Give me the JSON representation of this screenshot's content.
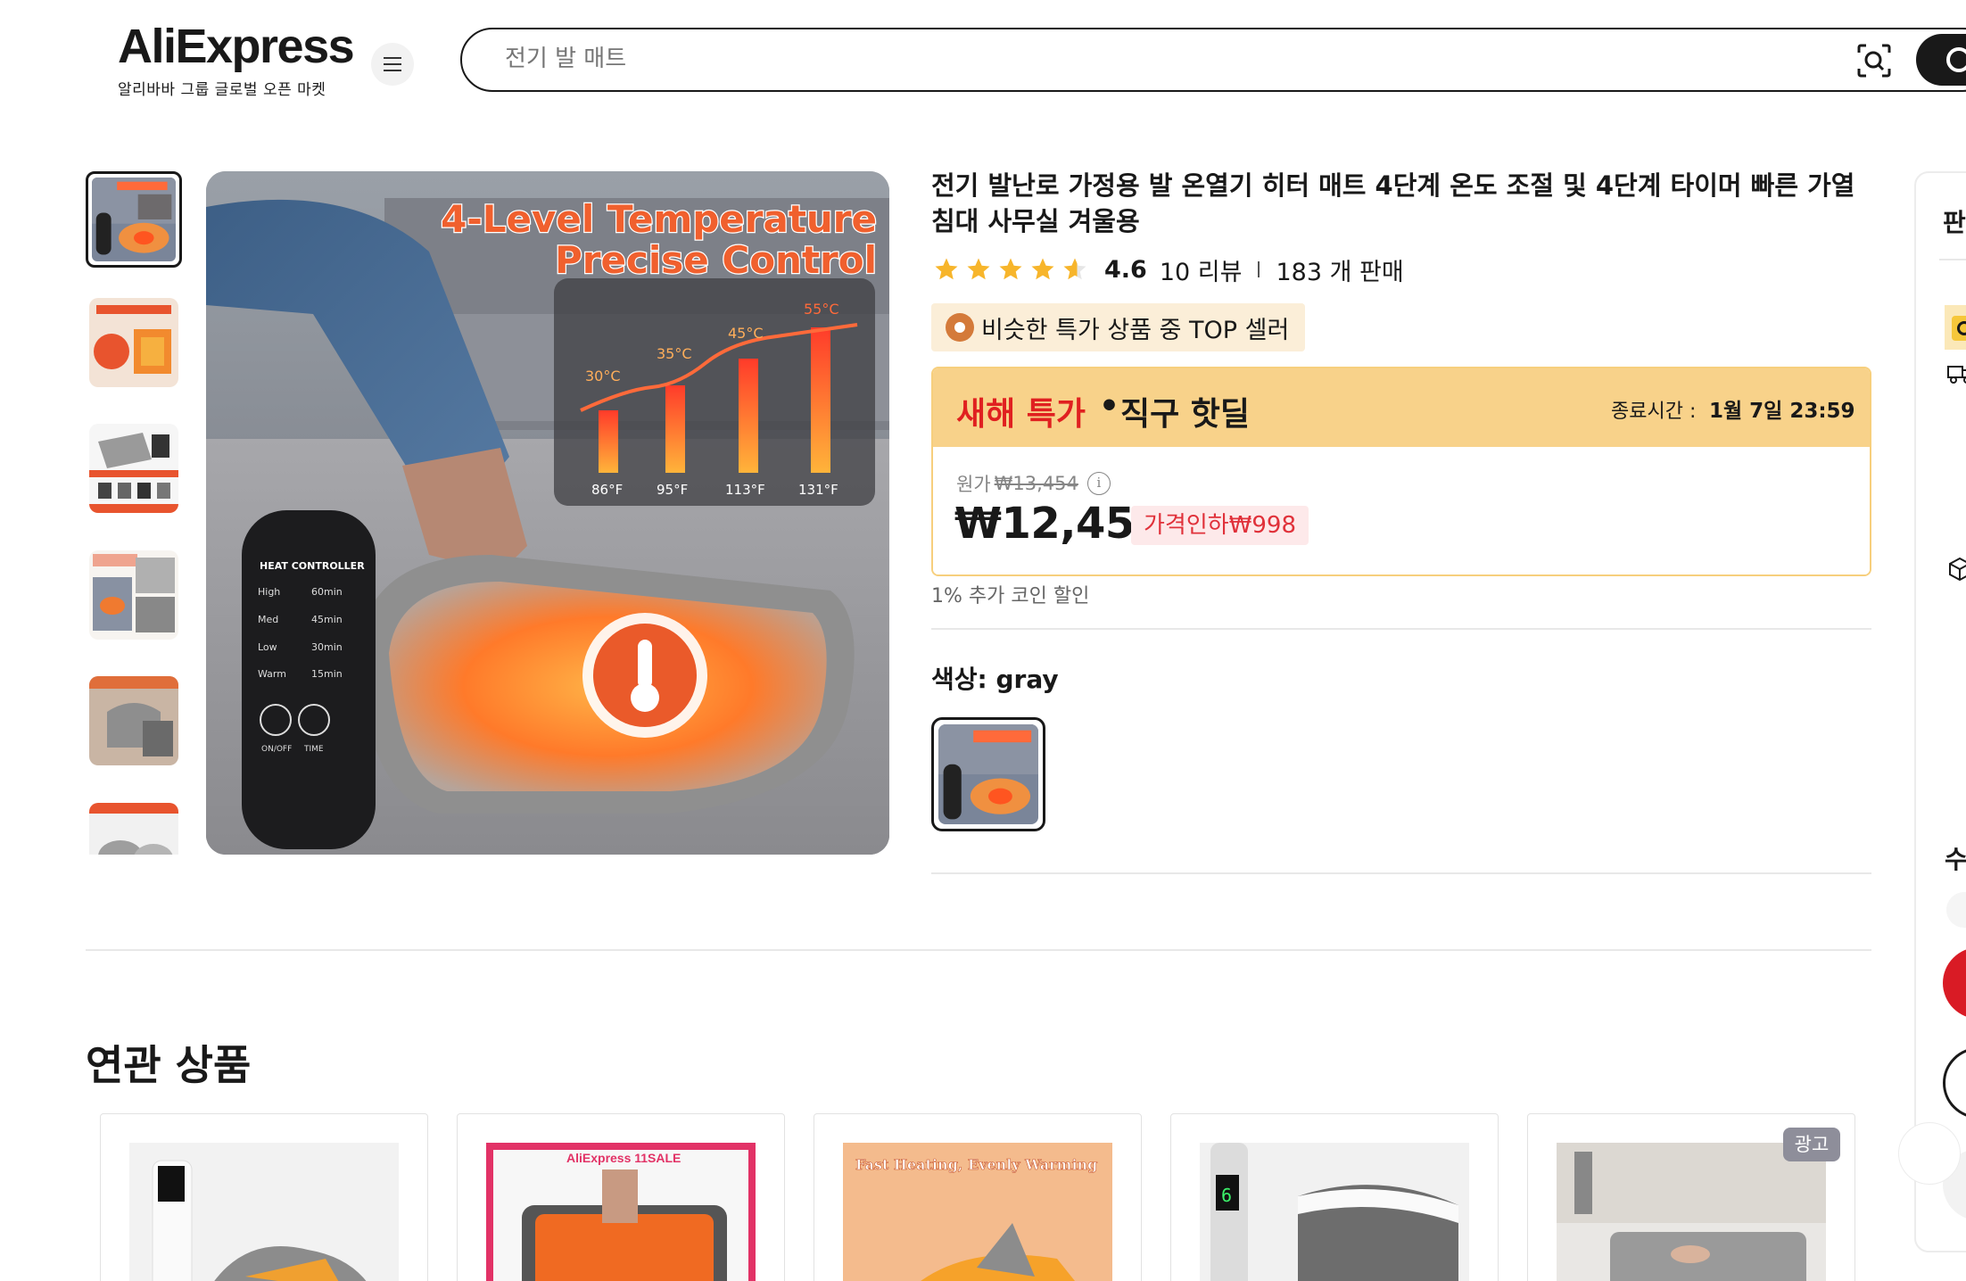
{
  "header": {
    "logo_text": "AliExpress",
    "logo_tagline": "알리바바 그룹 글로벌 오픈 마켓",
    "search_placeholder": "전기 발 매트"
  },
  "gallery": {
    "main_image_text": {
      "headline_line1": "4-Level Temperature",
      "headline_line2": "Precise Control",
      "temps_c": [
        "30°C",
        "35°C",
        "45°C",
        "55°C"
      ],
      "temps_f": [
        "86°F",
        "95°F",
        "113°F",
        "131°F"
      ],
      "controller_title": "HEAT CONTROLLER",
      "controller_levels": [
        "High",
        "Med",
        "Low",
        "Warm"
      ],
      "controller_times": [
        "60min",
        "45min",
        "30min",
        "15min"
      ],
      "controller_buttons": [
        "ON/OFF",
        "TIME"
      ]
    },
    "thumbnail_count": 6
  },
  "product": {
    "title": "전기 발난로 가정용 발 온열기 히터 매트 4단계 온도 조절 및 4단계 타이머 빠른 가열 침대 사무실 겨울용",
    "rating": "4.6",
    "rating_value": 4.6,
    "reviews": "10 리뷰",
    "sold": "183 개 판매",
    "top_badge": "비슷한 특가 상품 중 TOP 셀러",
    "deal": {
      "label_red": "새해 특가",
      "label_dot": "•",
      "label_black": "직구 핫딜",
      "end_label": "종료시간 :",
      "end_time": "1월 7일 23:59"
    },
    "original_price_label": "원가",
    "original_price": "₩13,454",
    "price": "₩12,456",
    "discount": "가격인하₩998",
    "coin_discount": "1% 추가 코인 할인",
    "color_label": "색상: gray"
  },
  "side_panel": {
    "title_char": "판",
    "qty_char": "수"
  },
  "related": {
    "title": "연관 상품",
    "ad_label": "광고",
    "cards": [
      {
        "img_text": ""
      },
      {
        "img_text": "AliExpress 11SALE"
      },
      {
        "img_text": "Fast Heating, Evenly Warming"
      },
      {
        "img_text": ""
      },
      {
        "img_text": ""
      }
    ]
  },
  "colors": {
    "accent_red": "#e02020",
    "deal_yellow": "#f8d28a",
    "star": "#f7b52b",
    "text": "#191919"
  }
}
